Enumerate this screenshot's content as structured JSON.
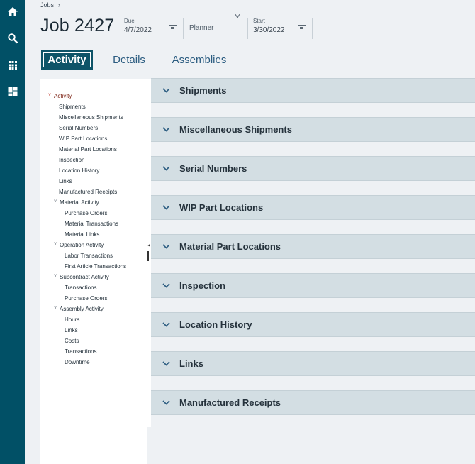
{
  "rail": {
    "items": [
      {
        "icon": "home-icon"
      },
      {
        "icon": "search-icon"
      },
      {
        "icon": "apps-grid-icon"
      },
      {
        "icon": "dashboard-icon"
      }
    ]
  },
  "breadcrumb": {
    "item": "Jobs"
  },
  "job": {
    "title": "Job 2427"
  },
  "fields": {
    "due_label": "Due",
    "due_value": "4/7/2022",
    "planner_label": "Planner",
    "start_label": "Start",
    "start_value": "3/30/2022"
  },
  "tabs": [
    {
      "label": "Activity"
    },
    {
      "label": "Details"
    },
    {
      "label": "Assemblies"
    }
  ],
  "tree": {
    "root": "Activity",
    "items": [
      "Shipments",
      "Miscellaneous Shipments",
      "Serial Numbers",
      "WIP Part Locations",
      "Material Part Locations",
      "Inspection",
      "Location History",
      "Links",
      "Manufactured Receipts"
    ],
    "groups": [
      {
        "label": "Material Activity",
        "children": [
          "Purchase Orders",
          "Material Transactions",
          "Material Links"
        ]
      },
      {
        "label": "Operation Activity",
        "children": [
          "Labor Transactions",
          "First Article Transactions"
        ]
      },
      {
        "label": "Subcontract Activity",
        "children": [
          "Transactions",
          "Purchase Orders"
        ]
      },
      {
        "label": "Assembly Activity",
        "children": [
          "Hours",
          "Links",
          "Costs",
          "Transactions",
          "Downtime"
        ]
      }
    ]
  },
  "sections": [
    "Shipments",
    "Miscellaneous Shipments",
    "Serial Numbers",
    "WIP Part Locations",
    "Material Part Locations",
    "Inspection",
    "Location History",
    "Links",
    "Manufactured Receipts"
  ]
}
